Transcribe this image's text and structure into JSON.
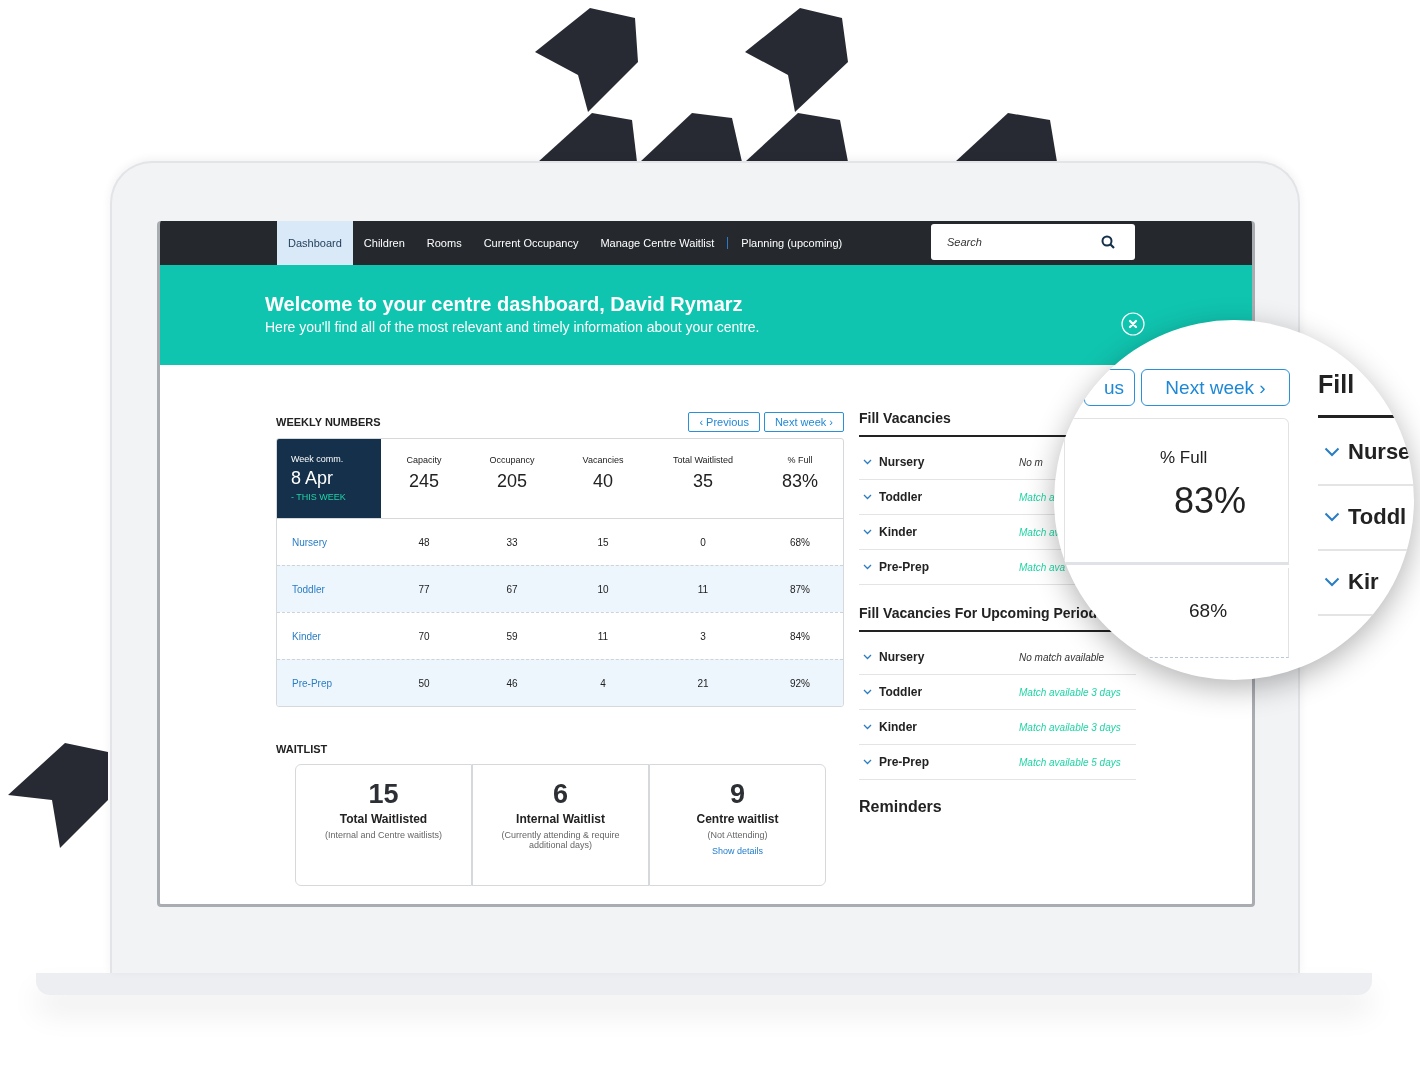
{
  "nav": {
    "tabs": [
      {
        "label": "Dashboard",
        "selected": true,
        "separator": false
      },
      {
        "label": "Children",
        "selected": false,
        "separator": false
      },
      {
        "label": "Rooms",
        "selected": false,
        "separator": false
      },
      {
        "label": "Current Occupancy",
        "selected": false,
        "separator": false
      },
      {
        "label": "Manage Centre Waitlist",
        "selected": false,
        "separator": false
      },
      {
        "label": "Planning (upcoming)",
        "selected": false,
        "separator": true
      }
    ],
    "search": {
      "placeholder": "Search"
    }
  },
  "banner": {
    "title": "Welcome to your centre dashboard, David Rymarz",
    "subtitle": "Here you'll find all of the most relevant and timely information about your centre."
  },
  "weekly": {
    "heading": "WEEKLY NUMBERS",
    "previous_button": "‹ Previous",
    "next_button": "Next week ›",
    "week": {
      "label": "Week comm.",
      "date": "8 Apr",
      "note": "- THIS WEEK"
    },
    "columns": [
      {
        "label": "Capacity",
        "total": "245"
      },
      {
        "label": "Occupancy",
        "total": "205"
      },
      {
        "label": "Vacancies",
        "total": "40"
      },
      {
        "label": "Total Waitlisted",
        "total": "35"
      },
      {
        "label": "% Full",
        "total": "83%"
      }
    ],
    "rows": [
      {
        "name": "Nursery",
        "values": [
          "48",
          "33",
          "15",
          "0",
          "68%"
        ]
      },
      {
        "name": "Toddler",
        "values": [
          "77",
          "67",
          "10",
          "11",
          "87%"
        ]
      },
      {
        "name": "Kinder",
        "values": [
          "70",
          "59",
          "11",
          "3",
          "84%"
        ]
      },
      {
        "name": "Pre-Prep",
        "values": [
          "50",
          "46",
          "4",
          "21",
          "92%"
        ]
      }
    ]
  },
  "waitlist": {
    "heading": "WAITLIST",
    "cards": [
      {
        "number": "15",
        "title": "Total Waitlisted",
        "note": "(Internal and Centre waitlists)"
      },
      {
        "number": "6",
        "title": "Internal Waitlist",
        "note": "(Currently attending & require additional days)"
      },
      {
        "number": "9",
        "title": "Centre waitlist",
        "note": "(Not Attending)",
        "link": "Show details"
      }
    ]
  },
  "sections": [
    {
      "heading": "Fill Vacancies",
      "items": [
        {
          "name": "Nursery",
          "status": "No m",
          "kind": "none"
        },
        {
          "name": "Toddler",
          "status": "Match a",
          "kind": "match"
        },
        {
          "name": "Kinder",
          "status": "Match av",
          "kind": "match"
        },
        {
          "name": "Pre-Prep",
          "status": "Match ava",
          "kind": "match"
        }
      ]
    },
    {
      "heading": "Fill Vacancies For Upcoming Period",
      "items": [
        {
          "name": "Nursery",
          "status": "No match available",
          "kind": "none"
        },
        {
          "name": "Toddler",
          "status": "Match available 3 days",
          "kind": "match"
        },
        {
          "name": "Kinder",
          "status": "Match available 3 days",
          "kind": "match"
        },
        {
          "name": "Pre-Prep",
          "status": "Match available 5 days",
          "kind": "match"
        }
      ]
    }
  ],
  "reminders": {
    "heading": "Reminders"
  },
  "magnifier": {
    "previous_button": "us",
    "next_button": "Next week ›",
    "column_label": "% Full",
    "column_value": "83%",
    "row_value": "68%",
    "heading": "Fill",
    "items": [
      "Nurse",
      "Toddl",
      "Kir"
    ]
  }
}
